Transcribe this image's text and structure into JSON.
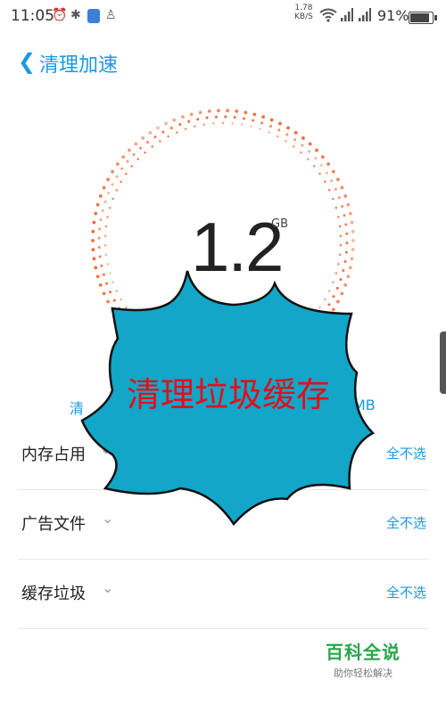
{
  "status": {
    "time": "11:05",
    "speed_value": "1.78",
    "speed_unit": "KB/S",
    "battery": "91%"
  },
  "header": {
    "title": "清理加速"
  },
  "storage": {
    "value": "1.2",
    "unit": "GB",
    "peek_left": "清",
    "peek_right": "MB"
  },
  "rows": [
    {
      "label": "内存占用",
      "action": "全不选"
    },
    {
      "label": "广告文件",
      "action": "全不选"
    },
    {
      "label": "缓存垃圾",
      "action": "全不选"
    }
  ],
  "overlay": {
    "text": "清理垃圾缓存",
    "fill": "#12a6c8",
    "text_color": "#e0101a"
  },
  "watermark": {
    "title": "百科全说",
    "subtitle": "助你轻松解决"
  },
  "colors": {
    "accent": "#1a98e6",
    "dial_dots": "#f06a3c"
  }
}
